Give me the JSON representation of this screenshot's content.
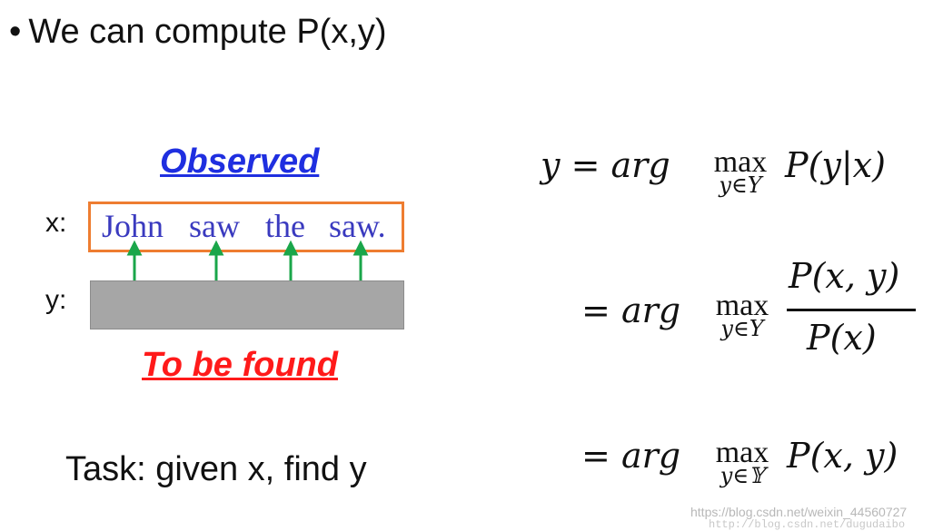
{
  "bullet": {
    "dot": "•",
    "text": "We can compute P(x,y)"
  },
  "diagram": {
    "observed_label": "Observed",
    "to_be_found_label": "To be found",
    "x_label": "x:",
    "y_label": "y:",
    "words": [
      "John",
      "saw",
      "the",
      "saw."
    ],
    "colors": {
      "box_border": "#ee7d31",
      "arrows": "#1aa64a",
      "observed": "#1f2fe0",
      "to_be_found": "#ff1a1a",
      "words": "#3a3abf",
      "y_box": "#a6a6a6"
    }
  },
  "task": "Task: given x, find y",
  "equations": {
    "eq1": {
      "lhs": "y",
      "equals": "=",
      "argword": "arg",
      "max": "max",
      "sub": "y∈Y",
      "rhs": "P(y|x)"
    },
    "eq2": {
      "equals": "=",
      "argword": "arg",
      "max": "max",
      "sub": "y∈Y",
      "numerator": "P(x, y)",
      "denominator": "P(x)"
    },
    "eq3": {
      "equals": "=",
      "argword": "arg",
      "max": "max",
      "sub": "y∈𝕐",
      "rhs": "P(x, y)"
    }
  },
  "watermark": {
    "line1": "https://blog.csdn.net/weixin_44560727",
    "line2": "http://blog.csdn.net/dugudaibo"
  }
}
